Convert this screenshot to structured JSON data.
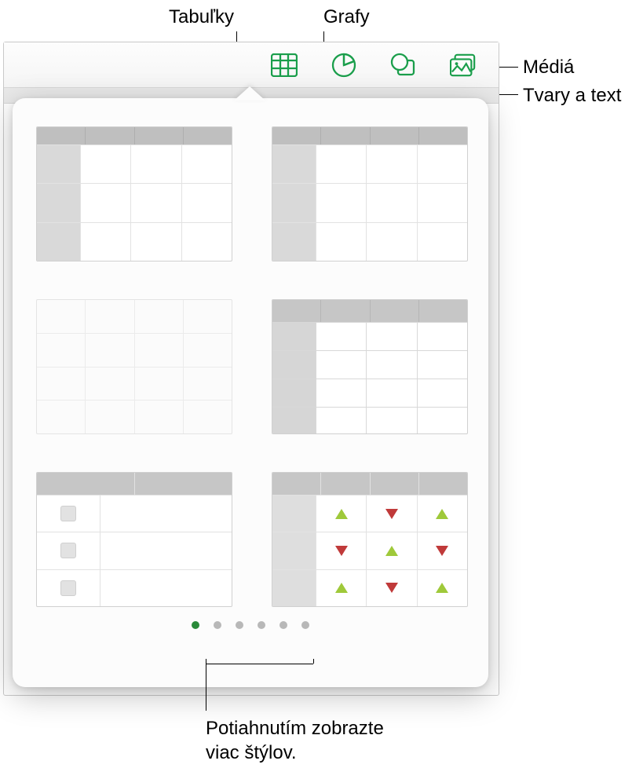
{
  "callouts": {
    "tables": "Tabuľky",
    "charts": "Grafy",
    "media": "Médiá",
    "shapes": "Tvary a text"
  },
  "toolbar": {
    "table_icon": "table-icon",
    "chart_icon": "chart-icon",
    "shape_icon": "shape-icon",
    "media_icon": "media-icon"
  },
  "popover": {
    "pager": {
      "count": 6,
      "active_index": 0
    },
    "styles": [
      {
        "name": "table-style-header-col-1"
      },
      {
        "name": "table-style-header-col-2"
      },
      {
        "name": "table-style-plain"
      },
      {
        "name": "table-style-grid-highlight"
      },
      {
        "name": "table-style-checkbox"
      },
      {
        "name": "table-style-indicators"
      }
    ]
  },
  "caption": {
    "line1": "Potiahnutím zobrazte",
    "line2": "viac štýlov."
  }
}
